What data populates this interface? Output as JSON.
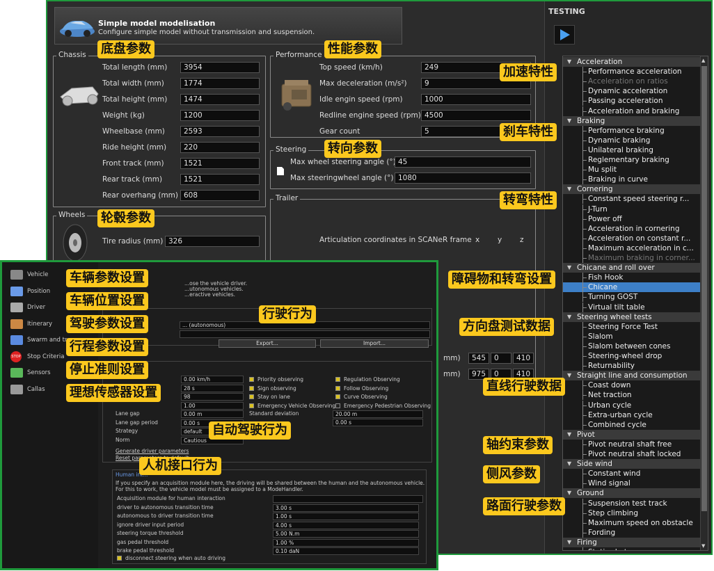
{
  "header": {
    "title": "Simple model modelisation",
    "subtitle": "Configure simple model without transmission and suspension."
  },
  "chassis": {
    "group_title": "Chassis",
    "annotation": "底盘参数",
    "fields": [
      {
        "label": "Total length (mm)",
        "value": "3954"
      },
      {
        "label": "Total width (mm)",
        "value": "1774"
      },
      {
        "label": "Total height (mm)",
        "value": "1474"
      },
      {
        "label": "Weight (kg)",
        "value": "1200"
      },
      {
        "label": "Wheelbase (mm)",
        "value": "2593"
      },
      {
        "label": "Ride height (mm)",
        "value": "220"
      },
      {
        "label": "Front track (mm)",
        "value": "1521"
      },
      {
        "label": "Rear track (mm)",
        "value": "1521"
      },
      {
        "label": "Rear overhang (mm)",
        "value": "608"
      }
    ]
  },
  "performance": {
    "group_title": "Performance",
    "annotation": "性能参数",
    "fields": [
      {
        "label": "Top speed (km/h)",
        "value": "249"
      },
      {
        "label": "Max deceleration (m/s²)",
        "value": "9"
      },
      {
        "label": "Idle engin speed (rpm)",
        "value": "1000"
      },
      {
        "label": "Redline engine speed (rpm)",
        "value": "4500"
      },
      {
        "label": "Gear count",
        "value": "5"
      }
    ]
  },
  "steering": {
    "group_title": "Steering",
    "annotation": "转向参数",
    "fields": [
      {
        "label": "Max wheel steering angle (°)",
        "value": "45"
      },
      {
        "label": "Max steeringwheel angle (°)",
        "value": "1080"
      }
    ]
  },
  "wheels": {
    "group_title": "Wheels",
    "annotation": "轮毂参数",
    "fields": [
      {
        "label": "Tire radius (mm)",
        "value": "326"
      }
    ]
  },
  "trailer": {
    "group_title": "Trailer",
    "articulation_label": "Articulation coordinates in SCANeR frame",
    "x": "x",
    "y": "y",
    "z": "z",
    "rows": [
      {
        "unit": "mm)",
        "v1": "545",
        "v2": "0",
        "v3": "410"
      },
      {
        "unit": "mm)",
        "v1": "975",
        "v2": "0",
        "v3": "410"
      }
    ]
  },
  "testing": {
    "title": "TESTING",
    "tree": [
      {
        "t": "cat",
        "label": "Acceleration"
      },
      {
        "t": "item",
        "label": "Performance acceleration"
      },
      {
        "t": "item",
        "label": "Acceleration on ratios",
        "dim": true
      },
      {
        "t": "item",
        "label": "Dynamic acceleration"
      },
      {
        "t": "item",
        "label": "Passing acceleration"
      },
      {
        "t": "item",
        "label": "Acceleration and braking"
      },
      {
        "t": "cat",
        "label": "Braking"
      },
      {
        "t": "item",
        "label": "Performance braking"
      },
      {
        "t": "item",
        "label": "Dynamic braking"
      },
      {
        "t": "item",
        "label": "Unilateral braking"
      },
      {
        "t": "item",
        "label": "Reglementary braking"
      },
      {
        "t": "item",
        "label": "Mu split"
      },
      {
        "t": "item",
        "label": "Braking in curve"
      },
      {
        "t": "cat",
        "label": "Cornering"
      },
      {
        "t": "item",
        "label": "Constant speed steering r..."
      },
      {
        "t": "item",
        "label": "J-Turn"
      },
      {
        "t": "item",
        "label": "Power off"
      },
      {
        "t": "item",
        "label": "Acceleration in cornering"
      },
      {
        "t": "item",
        "label": "Acceleration on constant r..."
      },
      {
        "t": "item",
        "label": "Maximum acceleration in c..."
      },
      {
        "t": "item",
        "label": "Maximum braking in corner...",
        "dim": true
      },
      {
        "t": "cat",
        "label": "Chicane and roll over"
      },
      {
        "t": "item",
        "label": "Fish Hook"
      },
      {
        "t": "item",
        "label": "Chicane",
        "sel": true
      },
      {
        "t": "item",
        "label": "Turning GOST"
      },
      {
        "t": "item",
        "label": "Virtual tilt table"
      },
      {
        "t": "cat",
        "label": "Steering wheel tests"
      },
      {
        "t": "item",
        "label": "Steering Force Test"
      },
      {
        "t": "item",
        "label": "Slalom"
      },
      {
        "t": "item",
        "label": "Slalom between cones"
      },
      {
        "t": "item",
        "label": "Steering-wheel drop"
      },
      {
        "t": "item",
        "label": "Returnability"
      },
      {
        "t": "cat",
        "label": "Straight line and consumption"
      },
      {
        "t": "item",
        "label": "Coast down"
      },
      {
        "t": "item",
        "label": "Net traction"
      },
      {
        "t": "item",
        "label": "Urban cycle"
      },
      {
        "t": "item",
        "label": "Extra-urban cycle"
      },
      {
        "t": "item",
        "label": "Combined cycle"
      },
      {
        "t": "cat",
        "label": "Pivot"
      },
      {
        "t": "item",
        "label": "Pivot neutral shaft free"
      },
      {
        "t": "item",
        "label": "Pivot neutral shaft locked"
      },
      {
        "t": "cat",
        "label": "Side wind"
      },
      {
        "t": "item",
        "label": "Constant wind"
      },
      {
        "t": "item",
        "label": "Wind signal"
      },
      {
        "t": "cat",
        "label": "Ground"
      },
      {
        "t": "item",
        "label": "Suspension test track"
      },
      {
        "t": "item",
        "label": "Step climbing"
      },
      {
        "t": "item",
        "label": "Maximum speed on obstacle"
      },
      {
        "t": "item",
        "label": "Fording"
      },
      {
        "t": "cat",
        "label": "Firing"
      },
      {
        "t": "item",
        "label": "Static shot"
      }
    ]
  },
  "tree_annotations": [
    "加速特性",
    "刹车特性",
    "转弯特性",
    "障碍物和转弯设置",
    "方向盘测试数据",
    "直线行驶数据",
    "轴约束参数",
    "侧风参数",
    "路面行驶参数"
  ],
  "driver": {
    "nav": [
      {
        "label": "Vehicle",
        "annotation": "车辆参数设置"
      },
      {
        "label": "Position",
        "annotation": "车辆位置设置"
      },
      {
        "label": "Driver",
        "annotation": "驾驶参数设置"
      },
      {
        "label": "Itinerary",
        "annotation": "行程参数设置"
      },
      {
        "label": "Swarm and tr...",
        "annotation": ""
      },
      {
        "label": "Stop Criteria",
        "annotation": "停止准则设置"
      },
      {
        "label": "Sensors",
        "annotation": "理想传感器设置"
      },
      {
        "label": "Callas",
        "annotation": ""
      }
    ],
    "stop_icon_text": "STOP",
    "intro": [
      "...ose the vehicle driver.",
      "...utonomous vehicles.",
      "...eractive vehicles."
    ],
    "driving_annotation": "行驶行为",
    "select_value": "... (autonomous)",
    "export": "Export...",
    "import": "Import...",
    "auto_annotation": "自动驾驶行为",
    "params": [
      {
        "label": "",
        "value": "0.00 km/h"
      },
      {
        "label": "",
        "value": "28 s"
      },
      {
        "label": "",
        "value": "98"
      },
      {
        "label": "",
        "value": "1.00"
      },
      {
        "label": "Lane gap",
        "value": "0.00 m"
      },
      {
        "label": "Lane gap period",
        "value": "0.00 s"
      },
      {
        "label": "Strategy",
        "value": "default"
      },
      {
        "label": "Norm",
        "value": "Cautious"
      }
    ],
    "checks_mid": [
      {
        "label": "Priority observing",
        "on": true
      },
      {
        "label": "Sign observing",
        "on": true
      },
      {
        "label": "Stay on lane",
        "on": true
      },
      {
        "label": "Emergency Vehicle Observing",
        "on": true
      }
    ],
    "checks_right": [
      {
        "label": "Regulation Observing",
        "on": true
      },
      {
        "label": "Follow Observing",
        "on": true
      },
      {
        "label": "Curve Observing",
        "on": true
      },
      {
        "label": "Emergency Pedestrian Observing",
        "on": false
      }
    ],
    "std_dev_label": "Standard deviation",
    "std_dev_value": "20.00 m",
    "std_dev_value2": "0.00 s",
    "link1": "Generate driver parameters",
    "link2": "Reset parameters to default",
    "hmi_annotation": "人机接口行为",
    "human": {
      "title": "Human int...",
      "desc1": "If you specify an acquisition module here, the driving will be shared between the human and the autonomous vehicle.",
      "desc2": "For this to work, the vehicle model must be assigned to a ModeHandler.",
      "rows": [
        {
          "label": "Acquisition module for human interaction",
          "value": ""
        },
        {
          "label": "driver to autonomous transition time",
          "value": "3.00 s"
        },
        {
          "label": "autonomous to driver transition time",
          "value": "1.00 s"
        },
        {
          "label": "ignore driver input period",
          "value": "4.00 s"
        },
        {
          "label": "steering torque threshold",
          "value": "5.00 N.m"
        },
        {
          "label": "gas pedal threshold",
          "value": "1.00 %"
        },
        {
          "label": "brake pedal threshold",
          "value": "0.10 daN"
        }
      ],
      "disconnect": "disconnect steering when auto driving"
    }
  },
  "colors": {
    "frame": "#1f9a3c",
    "annotation_bg": "#fbc81e",
    "selected": "#3d7fc7"
  }
}
